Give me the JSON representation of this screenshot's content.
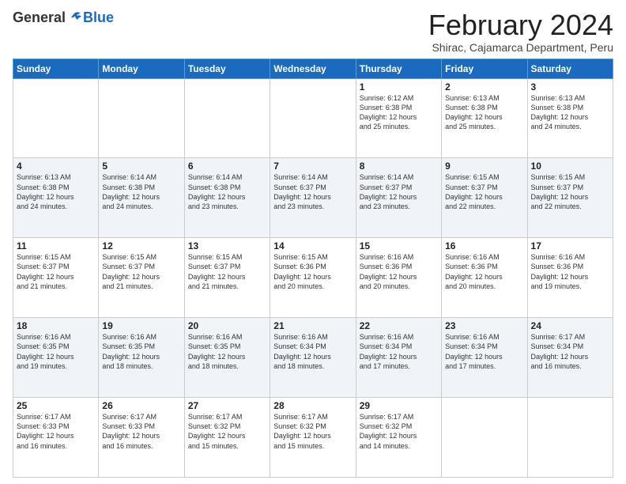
{
  "header": {
    "logo_general": "General",
    "logo_blue": "Blue",
    "month_title": "February 2024",
    "subtitle": "Shirac, Cajamarca Department, Peru"
  },
  "days_of_week": [
    "Sunday",
    "Monday",
    "Tuesday",
    "Wednesday",
    "Thursday",
    "Friday",
    "Saturday"
  ],
  "weeks": [
    [
      {
        "day": "",
        "info": ""
      },
      {
        "day": "",
        "info": ""
      },
      {
        "day": "",
        "info": ""
      },
      {
        "day": "",
        "info": ""
      },
      {
        "day": "1",
        "info": "Sunrise: 6:12 AM\nSunset: 6:38 PM\nDaylight: 12 hours\nand 25 minutes."
      },
      {
        "day": "2",
        "info": "Sunrise: 6:13 AM\nSunset: 6:38 PM\nDaylight: 12 hours\nand 25 minutes."
      },
      {
        "day": "3",
        "info": "Sunrise: 6:13 AM\nSunset: 6:38 PM\nDaylight: 12 hours\nand 24 minutes."
      }
    ],
    [
      {
        "day": "4",
        "info": "Sunrise: 6:13 AM\nSunset: 6:38 PM\nDaylight: 12 hours\nand 24 minutes."
      },
      {
        "day": "5",
        "info": "Sunrise: 6:14 AM\nSunset: 6:38 PM\nDaylight: 12 hours\nand 24 minutes."
      },
      {
        "day": "6",
        "info": "Sunrise: 6:14 AM\nSunset: 6:38 PM\nDaylight: 12 hours\nand 23 minutes."
      },
      {
        "day": "7",
        "info": "Sunrise: 6:14 AM\nSunset: 6:37 PM\nDaylight: 12 hours\nand 23 minutes."
      },
      {
        "day": "8",
        "info": "Sunrise: 6:14 AM\nSunset: 6:37 PM\nDaylight: 12 hours\nand 23 minutes."
      },
      {
        "day": "9",
        "info": "Sunrise: 6:15 AM\nSunset: 6:37 PM\nDaylight: 12 hours\nand 22 minutes."
      },
      {
        "day": "10",
        "info": "Sunrise: 6:15 AM\nSunset: 6:37 PM\nDaylight: 12 hours\nand 22 minutes."
      }
    ],
    [
      {
        "day": "11",
        "info": "Sunrise: 6:15 AM\nSunset: 6:37 PM\nDaylight: 12 hours\nand 21 minutes."
      },
      {
        "day": "12",
        "info": "Sunrise: 6:15 AM\nSunset: 6:37 PM\nDaylight: 12 hours\nand 21 minutes."
      },
      {
        "day": "13",
        "info": "Sunrise: 6:15 AM\nSunset: 6:37 PM\nDaylight: 12 hours\nand 21 minutes."
      },
      {
        "day": "14",
        "info": "Sunrise: 6:15 AM\nSunset: 6:36 PM\nDaylight: 12 hours\nand 20 minutes."
      },
      {
        "day": "15",
        "info": "Sunrise: 6:16 AM\nSunset: 6:36 PM\nDaylight: 12 hours\nand 20 minutes."
      },
      {
        "day": "16",
        "info": "Sunrise: 6:16 AM\nSunset: 6:36 PM\nDaylight: 12 hours\nand 20 minutes."
      },
      {
        "day": "17",
        "info": "Sunrise: 6:16 AM\nSunset: 6:36 PM\nDaylight: 12 hours\nand 19 minutes."
      }
    ],
    [
      {
        "day": "18",
        "info": "Sunrise: 6:16 AM\nSunset: 6:35 PM\nDaylight: 12 hours\nand 19 minutes."
      },
      {
        "day": "19",
        "info": "Sunrise: 6:16 AM\nSunset: 6:35 PM\nDaylight: 12 hours\nand 18 minutes."
      },
      {
        "day": "20",
        "info": "Sunrise: 6:16 AM\nSunset: 6:35 PM\nDaylight: 12 hours\nand 18 minutes."
      },
      {
        "day": "21",
        "info": "Sunrise: 6:16 AM\nSunset: 6:34 PM\nDaylight: 12 hours\nand 18 minutes."
      },
      {
        "day": "22",
        "info": "Sunrise: 6:16 AM\nSunset: 6:34 PM\nDaylight: 12 hours\nand 17 minutes."
      },
      {
        "day": "23",
        "info": "Sunrise: 6:16 AM\nSunset: 6:34 PM\nDaylight: 12 hours\nand 17 minutes."
      },
      {
        "day": "24",
        "info": "Sunrise: 6:17 AM\nSunset: 6:34 PM\nDaylight: 12 hours\nand 16 minutes."
      }
    ],
    [
      {
        "day": "25",
        "info": "Sunrise: 6:17 AM\nSunset: 6:33 PM\nDaylight: 12 hours\nand 16 minutes."
      },
      {
        "day": "26",
        "info": "Sunrise: 6:17 AM\nSunset: 6:33 PM\nDaylight: 12 hours\nand 16 minutes."
      },
      {
        "day": "27",
        "info": "Sunrise: 6:17 AM\nSunset: 6:32 PM\nDaylight: 12 hours\nand 15 minutes."
      },
      {
        "day": "28",
        "info": "Sunrise: 6:17 AM\nSunset: 6:32 PM\nDaylight: 12 hours\nand 15 minutes."
      },
      {
        "day": "29",
        "info": "Sunrise: 6:17 AM\nSunset: 6:32 PM\nDaylight: 12 hours\nand 14 minutes."
      },
      {
        "day": "",
        "info": ""
      },
      {
        "day": "",
        "info": ""
      }
    ]
  ]
}
